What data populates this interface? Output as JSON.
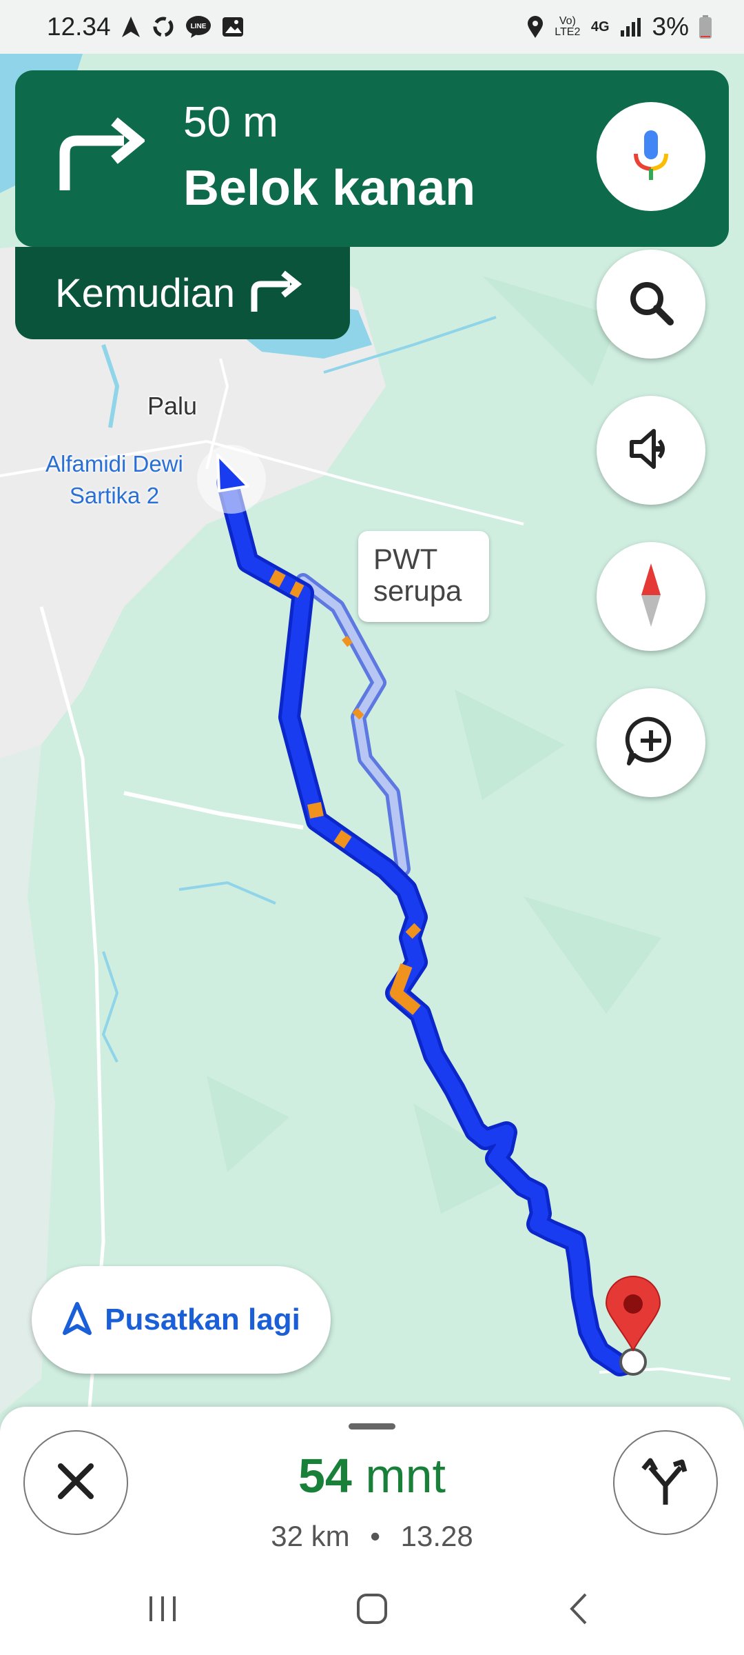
{
  "status_bar": {
    "time": "12.34",
    "network_type": "4G",
    "volte": "Vo) LTE2",
    "battery": "3%",
    "icons": [
      "navigation-arrow-icon",
      "sync-icon",
      "line-app-icon",
      "gallery-icon",
      "location-icon",
      "signal-icon",
      "battery-icon"
    ]
  },
  "navigation": {
    "distance": "50 m",
    "instruction": "Belok kanan",
    "then_label": "Kemudian",
    "turn_icon": "turn-right-icon",
    "then_icon": "turn-right-icon"
  },
  "map": {
    "city_label": "Palu",
    "poi_label_line1": "Alfamidi Dewi",
    "poi_label_line2": "Sartika 2",
    "route_callout_line1": "PWT",
    "route_callout_line2": "serupa",
    "colors": {
      "route_main": "#1a3cf0",
      "route_alt": "#8fa8ee",
      "traffic_slow": "#f0921e",
      "destination_pin": "#e53935",
      "land": "#cfeee0",
      "urban": "#ececec",
      "water": "#8fd4e8"
    }
  },
  "controls": {
    "mic_icon": "microphone-icon",
    "search_icon": "search-icon",
    "sound_icon": "volume-icon",
    "compass_icon": "compass-icon",
    "report_icon": "add-report-icon",
    "recenter_label": "Pusatkan lagi"
  },
  "trip": {
    "duration_number": "54",
    "duration_unit": "mnt",
    "distance": "32 km",
    "separator": "•",
    "arrival_time": "13.28"
  },
  "system_nav": {
    "recents_icon": "recents-icon",
    "home_icon": "home-icon",
    "back_icon": "back-icon"
  }
}
